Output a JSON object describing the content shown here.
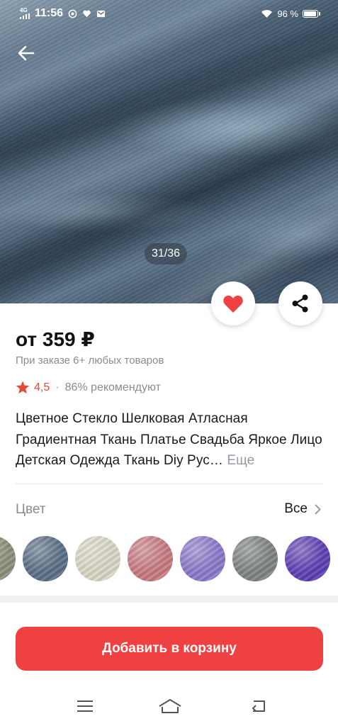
{
  "status_bar": {
    "network": "4G",
    "time": "11:56",
    "battery": "96 %"
  },
  "gallery": {
    "counter": "31/36"
  },
  "product": {
    "price": "от 359 ₽",
    "price_note": "При заказе 6+ любых товаров",
    "rating": "4,5",
    "recommend": "86% рекомендуют",
    "title": "Цветное Стекло Шелковая Атласная Градиентная Ткань Платье Свадьба Яркое Лицо Детская Одежда Ткань Diy Рус…",
    "more_label": "Еще"
  },
  "colors": {
    "label": "Цвет",
    "all_label": "Все",
    "swatches": [
      "#8d8f7c",
      "#5b6f84",
      "#d9d6c6",
      "#c77a82",
      "#8b79c9",
      "#7d8483",
      "#5d3fb4"
    ]
  },
  "cart": {
    "button_label": "Добавить в корзину"
  },
  "theme": {
    "accent": "#ef4141",
    "rating_color": "#e24a3a"
  }
}
